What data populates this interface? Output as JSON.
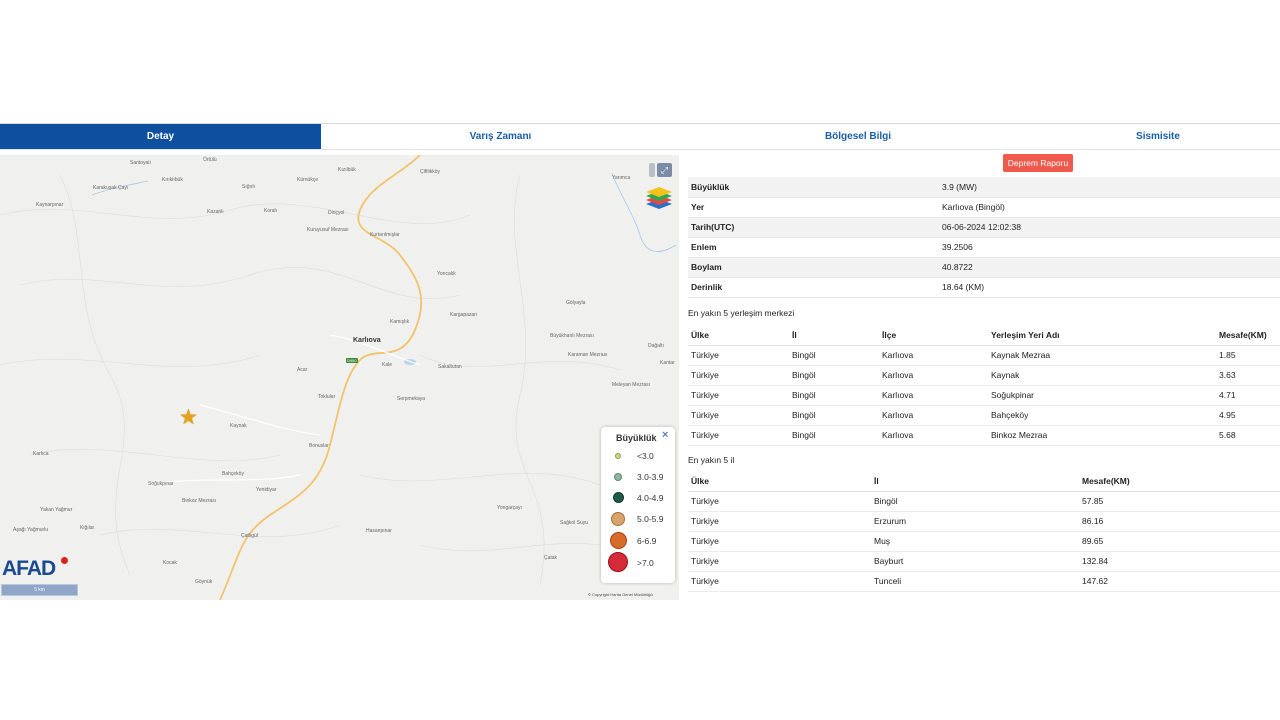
{
  "tabs": [
    "Detay",
    "Varış Zamanı",
    "Bölgesel Bilgi",
    "Sismisite"
  ],
  "map": {
    "places": [
      "Santoyalı",
      "Örtülü",
      "Kırıklıbük",
      "Karakuşak Çayı",
      "Kaynarpınar",
      "Kazanlı",
      "Koralı",
      "Sığırlı",
      "Kızılbük",
      "Kürnükçe",
      "Çiftlikköy",
      "Dinçyol",
      "Kuruyusuf Mezrası",
      "Kurtarılmışlar",
      "Yarımca",
      "Yoncalık",
      "Gölyayla",
      "Karlıova",
      "Kargapazarı",
      "Kamışlık",
      "Büyükhanlı Mezrası",
      "Karaman Mezrası",
      "Dağaltı",
      "Kantar",
      "Kale",
      "Sakaltutan",
      "Meleyan Mezrası",
      "Acar",
      "Toklular",
      "Serpmekaya",
      "Kaynak",
      "Bonuslar",
      "Karlıca",
      "Bahçeköy",
      "Soğukpınar",
      "Yenidiyar",
      "Binkoz Mezrası",
      "Yakan Yağmur",
      "Kiğılar",
      "Aşağı Yağmurlu",
      "Çatlıgül",
      "Hasanpınar",
      "Yongarçayı",
      "Çatak",
      "Göynük",
      "Kocak",
      "Sağkol Suyu"
    ],
    "road_label": "D950",
    "scale_label": "5 km",
    "logo_text": "AFAD",
    "copyright": "© Copyright Harita Genel Müdürlüğü"
  },
  "legend": {
    "title": "Büyüklük",
    "close": "×",
    "items": [
      {
        "label": "<3.0",
        "color": "#c9d98a"
      },
      {
        "label": "3.0-3.9",
        "color": "#8fb8a0"
      },
      {
        "label": "4.0-4.9",
        "color": "#1f5a4a"
      },
      {
        "label": "5.0-5.9",
        "color": "#d9a46a"
      },
      {
        "label": "6-6.9",
        "color": "#d86a2a"
      },
      {
        "label": ">7.0",
        "color": "#d42a3a"
      }
    ]
  },
  "report_button": "Deprem Raporu",
  "details": [
    {
      "key": "Büyüklük",
      "value": "3.9 (MW)"
    },
    {
      "key": "Yer",
      "value": "Karlıova (Bingöl)"
    },
    {
      "key": "Tarih(UTC)",
      "value": "06-06-2024 12:02:38"
    },
    {
      "key": "Enlem",
      "value": "39.2506"
    },
    {
      "key": "Boylam",
      "value": "40.8722"
    },
    {
      "key": "Derinlik",
      "value": "18.64 (KM)"
    }
  ],
  "settlements": {
    "title": "En yakın 5 yerleşim merkezi",
    "headers": [
      "Ülke",
      "İl",
      "İlçe",
      "Yerleşim Yeri Adı",
      "Mesafe(KM)"
    ],
    "rows": [
      [
        "Türkiye",
        "Bingöl",
        "Karlıova",
        "Kaynak Mezraa",
        "1.85"
      ],
      [
        "Türkiye",
        "Bingöl",
        "Karlıova",
        "Kaynak",
        "3.63"
      ],
      [
        "Türkiye",
        "Bingöl",
        "Karlıova",
        "Soğukpinar",
        "4.71"
      ],
      [
        "Türkiye",
        "Bingöl",
        "Karlıova",
        "Bahçeköy",
        "4.95"
      ],
      [
        "Türkiye",
        "Bingöl",
        "Karlıova",
        "Binkoz Mezraa",
        "5.68"
      ]
    ]
  },
  "provinces": {
    "title": "En yakın 5 il",
    "headers": [
      "Ülke",
      "İl",
      "Mesafe(KM)"
    ],
    "rows": [
      [
        "Türkiye",
        "Bingöl",
        "57.85"
      ],
      [
        "Türkiye",
        "Erzurum",
        "86.16"
      ],
      [
        "Türkiye",
        "Muş",
        "89.65"
      ],
      [
        "Türkiye",
        "Bayburt",
        "132.84"
      ],
      [
        "Türkiye",
        "Tunceli",
        "147.62"
      ]
    ]
  }
}
